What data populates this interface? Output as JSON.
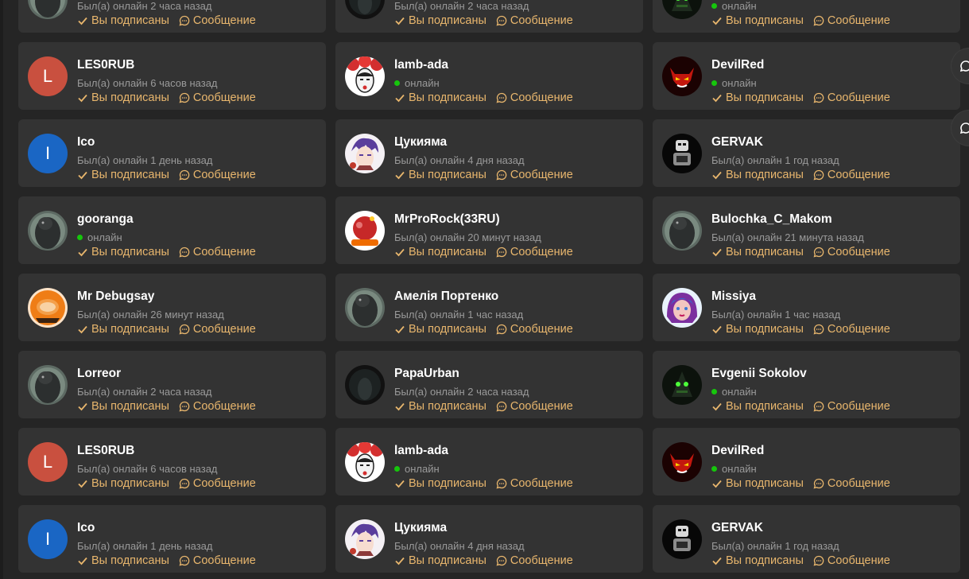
{
  "actions": {
    "subscribed_label": "Вы подписаны",
    "message_label": "Сообщение"
  },
  "colors": {
    "accent": "#e8b66d",
    "card": "#333333",
    "background": "#252525",
    "online": "#16c60c"
  },
  "users": [
    {
      "name": "",
      "status": "Был(а) онлайн 2 часа назад",
      "online": false,
      "avatar": "bird"
    },
    {
      "name": "",
      "status": "Был(а) онлайн 2 часа назад",
      "online": false,
      "avatar": "dark"
    },
    {
      "name": "",
      "status": "онлайн",
      "online": true,
      "avatar": "green"
    },
    {
      "name": "LES0RUB",
      "status": "Был(а) онлайн 6 часов назад",
      "online": false,
      "avatar": "letter",
      "letter": "L",
      "color": "#c9503f"
    },
    {
      "name": "lamb-ada",
      "status": "онлайн",
      "online": true,
      "avatar": "mask"
    },
    {
      "name": "DevilRed",
      "status": "онлайн",
      "online": true,
      "avatar": "devil"
    },
    {
      "name": "Ico",
      "status": "Был(а) онлайн 1 день назад",
      "online": false,
      "avatar": "letter",
      "letter": "I",
      "color": "#1a66c4"
    },
    {
      "name": "Цукияма",
      "status": "Был(а) онлайн 4 дня назад",
      "online": false,
      "avatar": "anime"
    },
    {
      "name": "GERVAK",
      "status": "Был(а) онлайн 1 год назад",
      "online": false,
      "avatar": "robot"
    },
    {
      "name": "gooranga",
      "status": "онлайн",
      "online": true,
      "avatar": "bird"
    },
    {
      "name": "MrProRock(33RU)",
      "status": "Был(а) онлайн 20 минут назад",
      "online": false,
      "avatar": "red"
    },
    {
      "name": "Bulochka_C_Makom",
      "status": "Был(а) онлайн 21 минута назад",
      "online": false,
      "avatar": "bird"
    },
    {
      "name": "Mr Debugsay",
      "status": "Был(а) онлайн 26 минут назад",
      "online": false,
      "avatar": "coffee"
    },
    {
      "name": "Амелія Портенко",
      "status": "Был(а) онлайн 1 час назад",
      "online": false,
      "avatar": "bird"
    },
    {
      "name": "Missiya",
      "status": "Был(а) онлайн 1 час назад",
      "online": false,
      "avatar": "girl"
    },
    {
      "name": "Lorreor",
      "status": "Был(а) онлайн 2 часа назад",
      "online": false,
      "avatar": "bird"
    },
    {
      "name": "PapaUrban",
      "status": "Был(а) онлайн 2 часа назад",
      "online": false,
      "avatar": "dark"
    },
    {
      "name": "Evgenii Sokolov",
      "status": "онлайн",
      "online": true,
      "avatar": "green"
    },
    {
      "name": "LES0RUB",
      "status": "Был(а) онлайн 6 часов назад",
      "online": false,
      "avatar": "letter",
      "letter": "L",
      "color": "#c9503f"
    },
    {
      "name": "lamb-ada",
      "status": "онлайн",
      "online": true,
      "avatar": "mask"
    },
    {
      "name": "DevilRed",
      "status": "онлайн",
      "online": true,
      "avatar": "devil"
    },
    {
      "name": "Ico",
      "status": "Был(а) онлайн 1 день назад",
      "online": false,
      "avatar": "letter",
      "letter": "I",
      "color": "#1a66c4"
    },
    {
      "name": "Цукияма",
      "status": "Был(а) онлайн 4 дня назад",
      "online": false,
      "avatar": "anime"
    },
    {
      "name": "GERVAK",
      "status": "Был(а) онлайн 1 год назад",
      "online": false,
      "avatar": "robot"
    }
  ]
}
